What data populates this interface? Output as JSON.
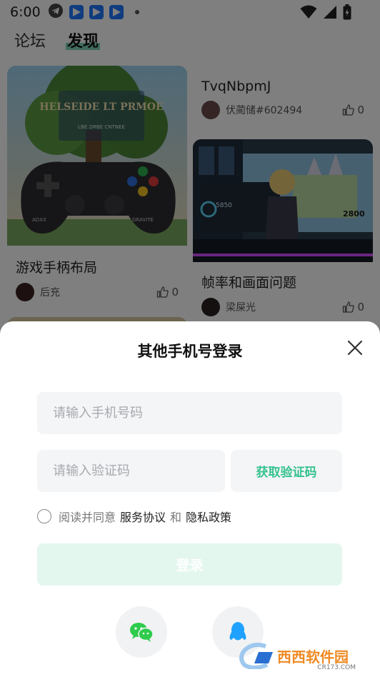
{
  "status_bar": {
    "time": "6:00"
  },
  "tabs": [
    {
      "label": "论坛",
      "active": false
    },
    {
      "label": "发现",
      "active": true
    }
  ],
  "feed": {
    "cards": [
      {
        "title": "游戏手柄布局",
        "author": "后充",
        "likes": "0"
      },
      {
        "title": "TvqNbpmJ",
        "author": "伏蔺储#602494",
        "likes": "0"
      },
      {
        "title": "帧率和画面问题",
        "author": "梁屎光",
        "likes": "0"
      }
    ],
    "image_text": "HELSEIDE LT PRMOE",
    "image_subtext": "LBE 2MBE CNTNEE",
    "controller_labels": [
      "ADXX",
      "GRAVITE"
    ],
    "monitor_labels": [
      "5850",
      "2800"
    ]
  },
  "login_sheet": {
    "title": "其他手机号登录",
    "phone_placeholder": "请输入手机号码",
    "code_placeholder": "请输入验证码",
    "get_code_label": "获取验证码",
    "agree_prefix": "阅读并同意",
    "service_link": "服务协议",
    "and_text": "和",
    "privacy_link": "隐私政策",
    "login_label": "登录"
  },
  "watermark": {
    "text": "西西软件园",
    "sub": "CR173.COM"
  },
  "colors": {
    "accent": "#36c28f",
    "login_disabled": "#e4f7ef",
    "tab_underline": "#7ed6b6"
  },
  "icons": [
    "telegram-icon",
    "app-icon",
    "wifi-icon",
    "signal-icon",
    "battery-icon",
    "thumbs-up-icon",
    "close-icon",
    "wechat-icon",
    "qq-icon"
  ]
}
